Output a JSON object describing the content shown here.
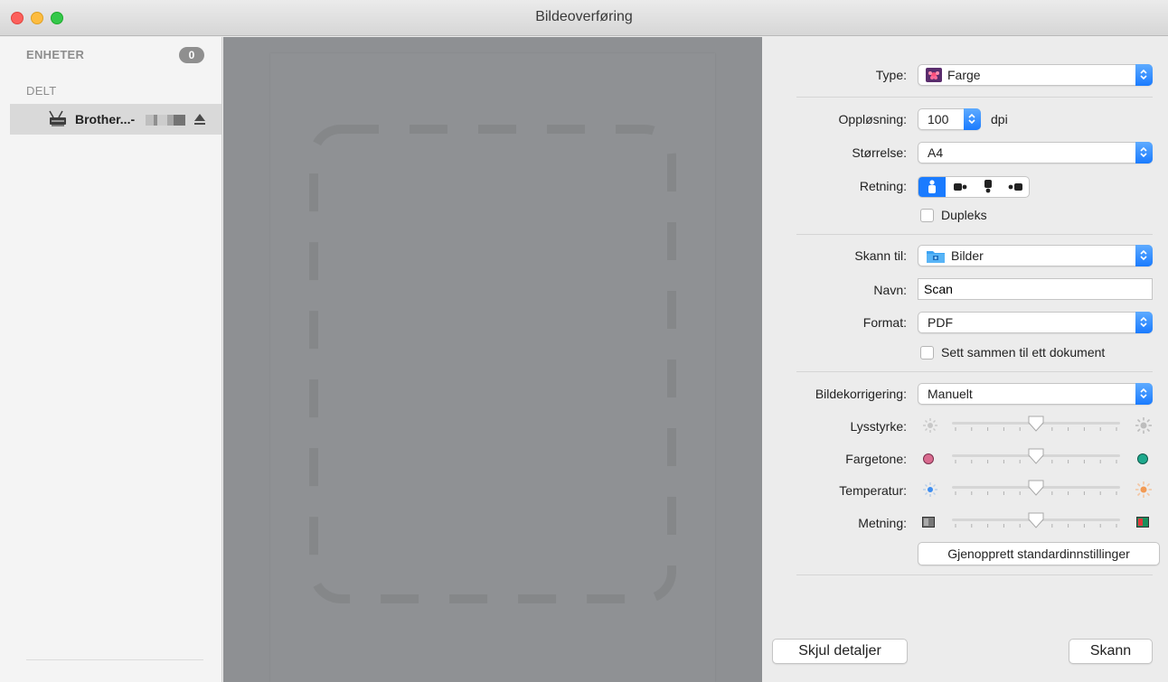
{
  "window": {
    "title": "Bildeoverføring"
  },
  "sidebar": {
    "devices_header": "ENHETER",
    "devices_count": "0",
    "shared_header": "DELT",
    "shared_items": [
      {
        "label": "Brother...-"
      }
    ]
  },
  "settings": {
    "type": {
      "label": "Type:",
      "value": "Farge"
    },
    "resolution": {
      "label": "Oppløsning:",
      "value": "100",
      "unit": "dpi"
    },
    "size": {
      "label": "Størrelse:",
      "value": "A4"
    },
    "orientation": {
      "label": "Retning:",
      "selected_index": 0
    },
    "duplex": {
      "label": "Dupleks",
      "checked": false
    },
    "scan_to": {
      "label": "Skann til:",
      "value": "Bilder"
    },
    "name": {
      "label": "Navn:",
      "value": "Scan"
    },
    "format": {
      "label": "Format:",
      "value": "PDF"
    },
    "combine": {
      "label": "Sett sammen til ett dokument",
      "checked": false
    },
    "image_correction": {
      "label": "Bildekorrigering:",
      "value": "Manuelt"
    },
    "sliders": [
      {
        "label": "Lysstyrke:",
        "value": 0.5
      },
      {
        "label": "Fargetone:",
        "value": 0.5
      },
      {
        "label": "Temperatur:",
        "value": 0.5
      },
      {
        "label": "Metning:",
        "value": 0.5
      }
    ],
    "restore_defaults": "Gjenopprett standardinnstillinger"
  },
  "footer": {
    "hide_details": "Skjul detaljer",
    "scan": "Skann"
  },
  "colors": {
    "accent": "#1a7bff",
    "preview_bg": "#8e9093",
    "close": "#fc605c",
    "minimize": "#fdbc40",
    "maximize": "#34c84a"
  }
}
